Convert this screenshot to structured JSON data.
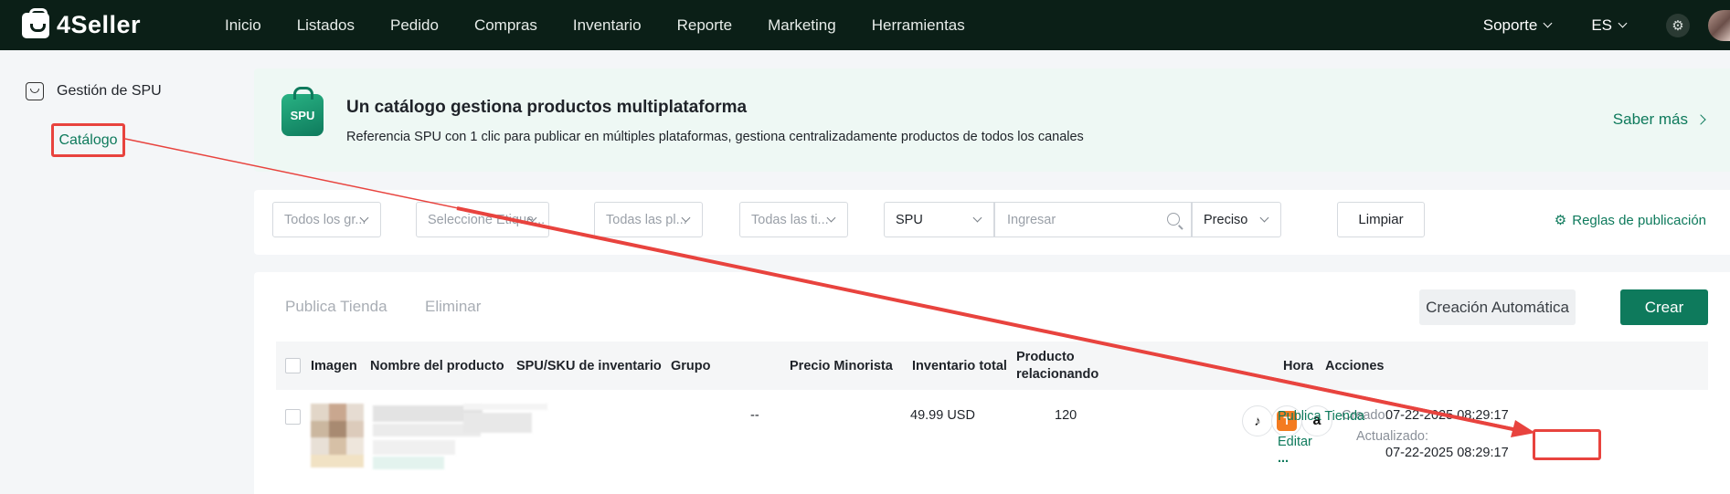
{
  "brand": {
    "name": "4Seller"
  },
  "nav": {
    "items": [
      "Inicio",
      "Listados",
      "Pedido",
      "Compras",
      "Inventario",
      "Reporte",
      "Marketing",
      "Herramientas"
    ],
    "support": "Soporte",
    "language": "ES"
  },
  "sidebar": {
    "section": "Gestión de SPU",
    "active_item": "Catálogo"
  },
  "banner": {
    "badge": "SPU",
    "title": "Un catálogo gestiona productos multiplataforma",
    "description": "Referencia SPU con 1 clic para publicar en múltiples plataformas, gestiona centralizadamente productos de todos los canales",
    "link": "Saber más"
  },
  "filters": {
    "group": "Todos los gr...",
    "tag": "Seleccione Etique...",
    "platform": "Todas las pl...",
    "store": "Todas las ti...",
    "search_field": "SPU",
    "search_placeholder": "Ingresar",
    "match": "Preciso",
    "clear": "Limpiar",
    "rules": "Reglas de publicación"
  },
  "toolbar": {
    "publish": "Publica Tienda",
    "delete": "Eliminar",
    "auto_create": "Creación Automática",
    "create": "Crear"
  },
  "table": {
    "headers": {
      "image": "Imagen",
      "name": "Nombre del producto",
      "sku": "SPU/SKU de inventario",
      "group": "Grupo",
      "price": "Precio Minorista",
      "inventory": "Inventario total",
      "related": "Producto relacionando",
      "time": "Hora",
      "actions": "Acciones"
    },
    "rows": [
      {
        "group": "--",
        "price": "49.99 USD",
        "inventory": "120",
        "created_label": "Creado:",
        "created": "07-22-2025 08:29:17",
        "updated_label": "Actualizado:",
        "updated": "07-22-2025 08:29:17",
        "platforms": [
          "tiktok",
          "temu",
          "amazon"
        ],
        "actions": {
          "publish": "Publica Tienda",
          "edit": "Editar",
          "more": "..."
        }
      }
    ]
  },
  "colors": {
    "primary": "#0e7a5c",
    "topbar": "#0b1f17",
    "annotation": "#e8433e"
  }
}
